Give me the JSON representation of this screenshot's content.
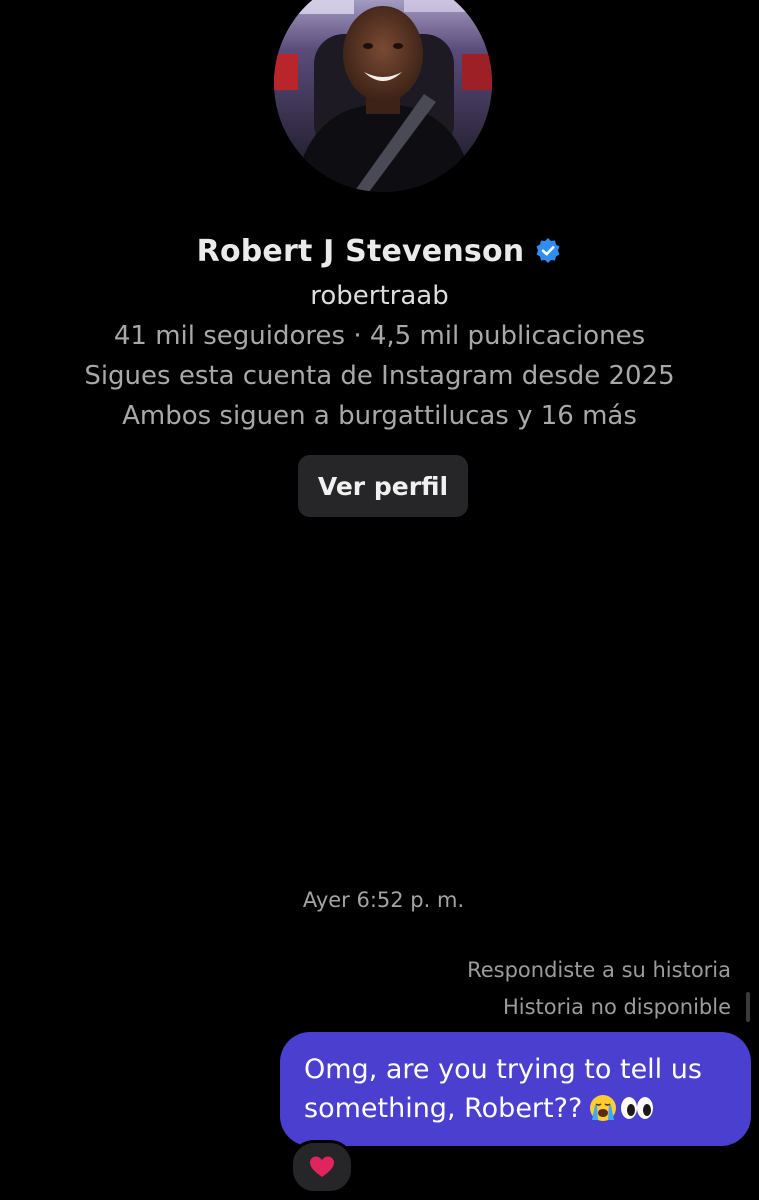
{
  "profile": {
    "name": "Robert J Stevenson",
    "username": "robertraab",
    "stats": "41 mil seguidores · 4,5 mil publicaciones",
    "following_since": "Sigues esta cuenta de Instagram desde 2025",
    "mutual": "Ambos siguen a burgattilucas y 16 más",
    "view_profile_label": "Ver perfil",
    "avatar_icon": "profile-photo",
    "verified_icon": "verified-badge-icon"
  },
  "thread": {
    "timestamp": "Ayer 6:52 p. m.",
    "story_reply_note": "Respondiste a su historia",
    "story_unavailable": "Historia no disponible",
    "message": {
      "text": "Omg, are you trying to tell us something, Robert??",
      "emojis": [
        "loudly-crying-face",
        "eyes"
      ],
      "bubble_color": "#4b3fcf"
    },
    "reaction": "red-heart"
  },
  "colors": {
    "background": "#000000",
    "button": "#262629",
    "verified": "#2f8cf0",
    "heart": "#e0245e"
  }
}
